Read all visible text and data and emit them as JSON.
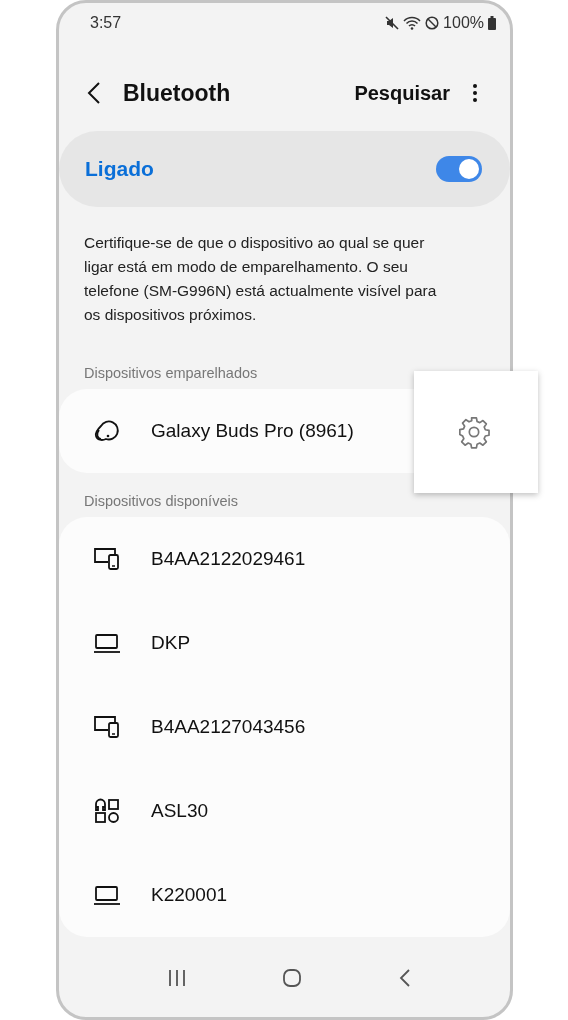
{
  "status_bar": {
    "time": "3:57",
    "battery": "100%"
  },
  "header": {
    "title": "Bluetooth",
    "action": "Pesquisar"
  },
  "bluetooth": {
    "label": "Ligado",
    "on": true
  },
  "description": "Certifique-se de que o dispositivo ao qual se quer ligar está em modo de emparelhamento. O seu telefone (SM-G996N) está actualmente visível para os dispositivos próximos.",
  "paired": {
    "heading": "Dispositivos emparelhados",
    "devices": [
      {
        "name": "Galaxy Buds Pro (8961)",
        "kind": "earbuds"
      }
    ]
  },
  "available": {
    "heading": "Dispositivos disponíveis",
    "devices": [
      {
        "name": "B4AA2122029461",
        "kind": "devices"
      },
      {
        "name": "DKP",
        "kind": "laptop"
      },
      {
        "name": "B4AA2127043456",
        "kind": "devices"
      },
      {
        "name": "ASL30",
        "kind": "other"
      },
      {
        "name": "K220001",
        "kind": "laptop"
      }
    ]
  }
}
